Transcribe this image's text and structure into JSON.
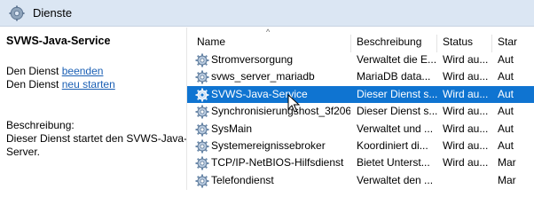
{
  "window": {
    "title": "Dienste",
    "icon": "gear-icon"
  },
  "left_panel": {
    "service_title": "SVWS-Java-Service",
    "action1_prefix": "Den Dienst",
    "action1_link": "beenden",
    "action2_prefix": "Den Dienst",
    "action2_link": "neu starten",
    "description_label": "Beschreibung:",
    "description_line1": "Dieser Dienst startet den SVWS-Java-",
    "description_line2": "Server."
  },
  "table": {
    "sort_indicator": "^",
    "columns": [
      "Name",
      "Beschreibung",
      "Status",
      "Star"
    ],
    "rows": [
      {
        "name": "Stromversorgung",
        "description": "Verwaltet die E...",
        "status": "Wird au...",
        "start": "Aut"
      },
      {
        "name": "svws_server_mariadb",
        "description": "MariaDB data...",
        "status": "Wird au...",
        "start": "Aut"
      },
      {
        "name": "SVWS-Java-Service",
        "description": "Dieser Dienst s...",
        "status": "Wird au...",
        "start": "Aut",
        "selected": true
      },
      {
        "name": "Synchronisierungshost_3f206",
        "description": "Dieser Dienst s...",
        "status": "Wird au...",
        "start": "Aut"
      },
      {
        "name": "SysMain",
        "description": "Verwaltet und ...",
        "status": "Wird au...",
        "start": "Aut"
      },
      {
        "name": "Systemereignissebroker",
        "description": "Koordiniert di...",
        "status": "Wird au...",
        "start": "Aut"
      },
      {
        "name": "TCP/IP-NetBIOS-Hilfsdienst",
        "description": "Bietet Unterst...",
        "status": "Wird au...",
        "start": "Mar"
      },
      {
        "name": "Telefondienst",
        "description": "Verwaltet den ...",
        "status": "",
        "start": "Mar"
      }
    ]
  },
  "colors": {
    "selection": "#0f74d1",
    "link": "#1a5fb4",
    "header_bg": "#dbe6f3"
  }
}
